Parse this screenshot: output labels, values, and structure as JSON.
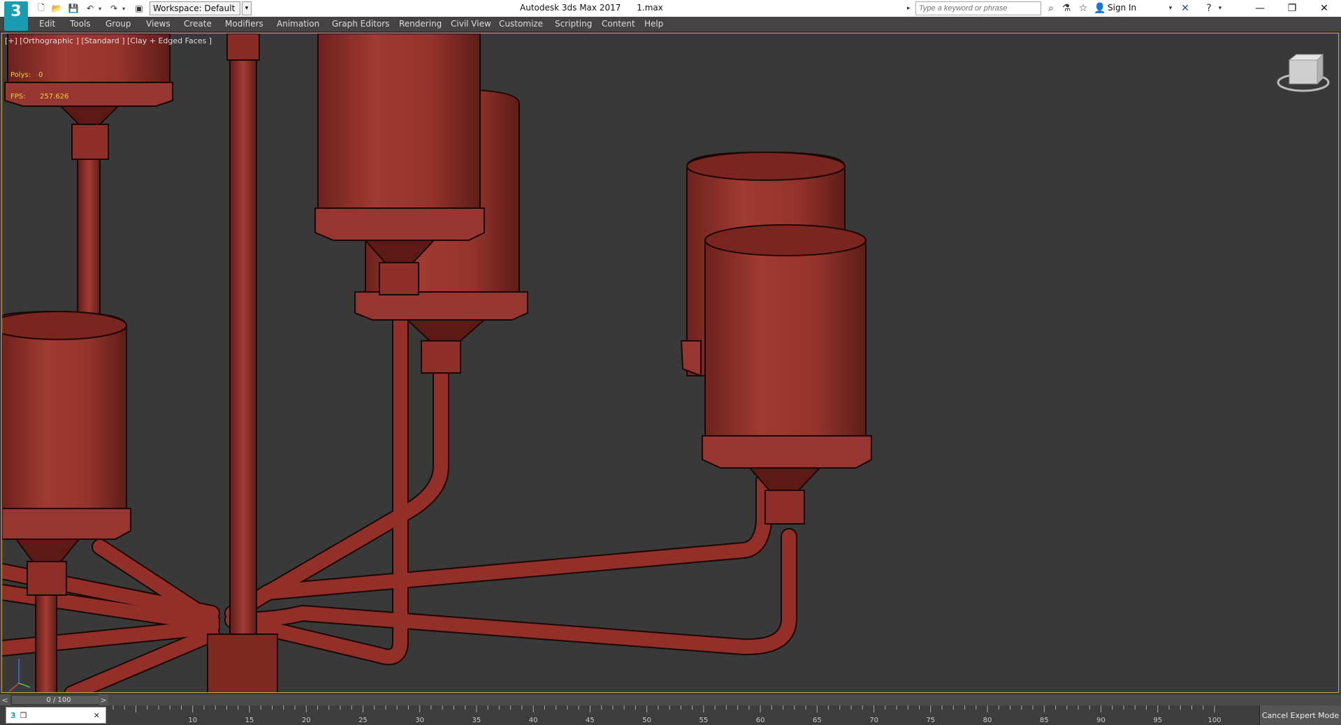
{
  "titlebar": {
    "logo": "3",
    "workspace": "Workspace: Default",
    "title": "Autodesk 3ds Max 2017      1.max",
    "search_placeholder": "Type a keyword or phrase",
    "sign_in": "Sign In"
  },
  "menu": [
    "Edit",
    "Tools",
    "Group",
    "Views",
    "Create",
    "Modifiers",
    "Animation",
    "Graph Editors",
    "Rendering",
    "Civil View",
    "Customize",
    "Scripting",
    "Content",
    "Help"
  ],
  "viewport": {
    "label": "[+] [Orthographic ] [Standard ] [Clay + Edged Faces ]",
    "polys_label": "Polys:",
    "polys_value": "0",
    "fps_label": "FPS:",
    "fps_value": "257.626",
    "border_color": "#c8a43a",
    "model_color": "#8e2f29"
  },
  "timeline": {
    "position": "0 / 100",
    "ticks": [
      "10",
      "15",
      "20",
      "25",
      "30",
      "35",
      "40",
      "45",
      "50",
      "55",
      "60",
      "65",
      "70",
      "75",
      "80",
      "85",
      "90",
      "95",
      "100"
    ],
    "cancel_expert": "Cancel Expert Mode"
  }
}
